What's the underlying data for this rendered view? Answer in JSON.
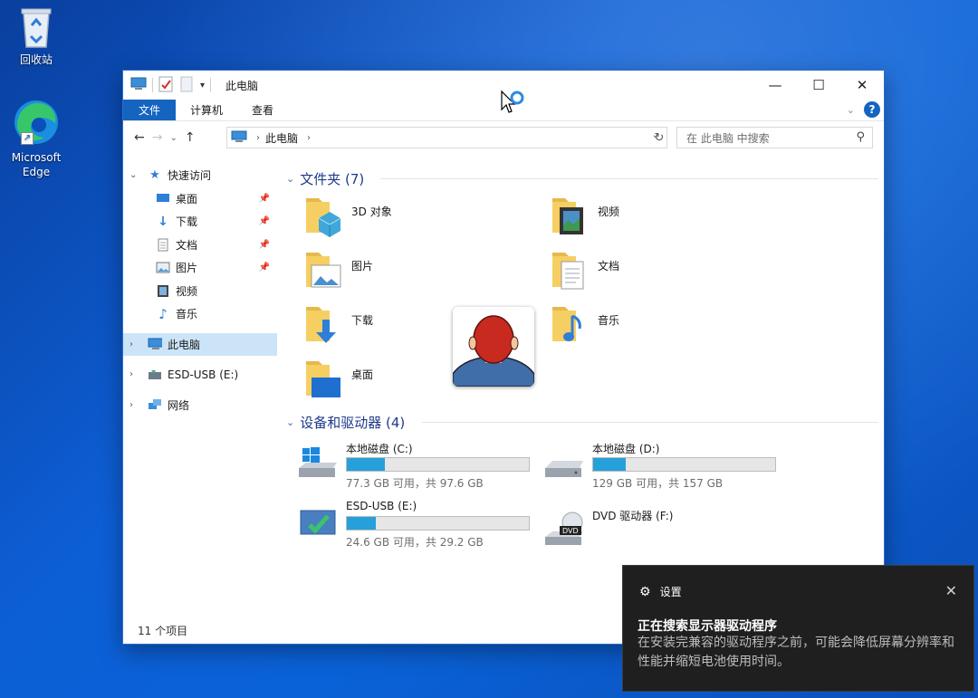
{
  "desktop": {
    "recycle_bin_label": "回收站",
    "edge_label": "Microsoft Edge"
  },
  "window": {
    "title": "此电脑",
    "quick_access_icons": [
      "computer-icon",
      "checkmark-properties-icon",
      "new-folder-icon",
      "dropdown-icon"
    ],
    "controls": {
      "minimize": "—",
      "maximize": "☐",
      "close": "✕"
    },
    "ribbon_tabs": [
      "文件",
      "计算机",
      "查看"
    ],
    "address": {
      "crumb": "此电脑",
      "search_placeholder": "在 此电脑 中搜索"
    },
    "status_text": "11 个项目"
  },
  "sidebar": {
    "quick_access": "快速访问",
    "quick_items": [
      {
        "label": "桌面",
        "icon": "desktop-icon",
        "pinned": true
      },
      {
        "label": "下载",
        "icon": "download-icon",
        "pinned": true
      },
      {
        "label": "文档",
        "icon": "document-icon",
        "pinned": true
      },
      {
        "label": "图片",
        "icon": "pictures-icon",
        "pinned": true
      },
      {
        "label": "视频",
        "icon": "video-icon",
        "pinned": false
      },
      {
        "label": "音乐",
        "icon": "music-icon",
        "pinned": false
      }
    ],
    "this_pc": "此电脑",
    "usb": "ESD-USB (E:)",
    "network": "网络"
  },
  "content": {
    "folders_header": "文件夹 (7)",
    "folders": [
      {
        "name": "3D 对象",
        "icon": "3d-objects-folder-icon"
      },
      {
        "name": "视频",
        "icon": "videos-folder-icon"
      },
      {
        "name": "图片",
        "icon": "pictures-folder-icon"
      },
      {
        "name": "文档",
        "icon": "documents-folder-icon"
      },
      {
        "name": "下载",
        "icon": "downloads-folder-icon"
      },
      {
        "name": "音乐",
        "icon": "music-folder-icon"
      },
      {
        "name": "桌面",
        "icon": "desktop-folder-icon"
      }
    ],
    "drives_header": "设备和驱动器 (4)",
    "drives": [
      {
        "name": "本地磁盘 (C:)",
        "info": "77.3 GB 可用，共 97.6 GB",
        "used_fraction": 0.21,
        "icon": "windows-drive-icon"
      },
      {
        "name": "本地磁盘 (D:)",
        "info": "129 GB 可用，共 157 GB",
        "used_fraction": 0.18,
        "icon": "hard-drive-icon"
      },
      {
        "name": "ESD-USB (E:)",
        "info": "24.6 GB 可用，共 29.2 GB",
        "used_fraction": 0.16,
        "icon": "usb-setup-drive-icon"
      },
      {
        "name": "DVD 驱动器 (F:)",
        "info": "",
        "used_fraction": null,
        "icon": "dvd-drive-icon"
      }
    ]
  },
  "toast": {
    "app": "设置",
    "title": "正在搜索显示器驱动程序",
    "body": "在安装完兼容的驱动程序之前，可能会降低屏幕分辨率和性能并缩短电池使用时间。"
  },
  "colors": {
    "accent": "#1565c0",
    "drive_fill": "#26a0da",
    "selection": "#cce4f7",
    "toast_bg": "#1f1f1f"
  }
}
